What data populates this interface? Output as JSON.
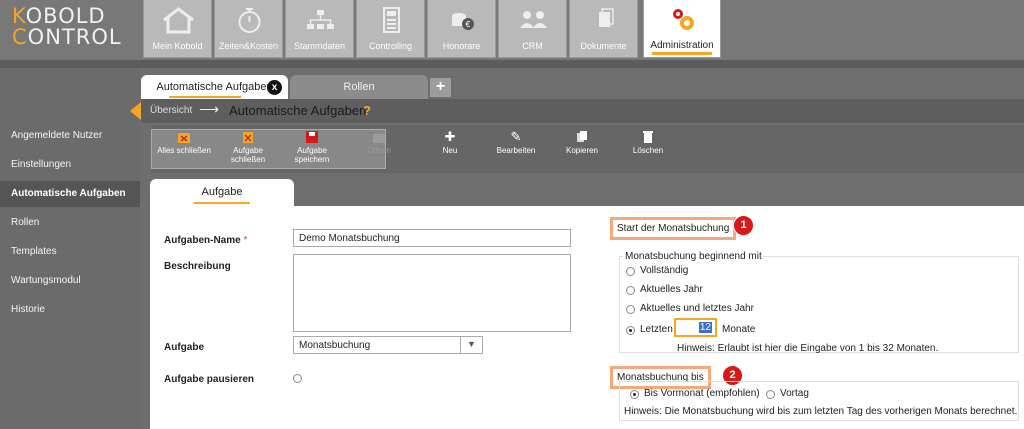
{
  "app": {
    "logo_line1": "OBOLD",
    "logo_line2": "ONTROL",
    "logo_k1": "K",
    "logo_k2": "C"
  },
  "nav": {
    "tabs": [
      {
        "label": "Mein Kobold",
        "icon": "home-icon"
      },
      {
        "label": "Zeiten&Kosten",
        "icon": "stopwatch-icon"
      },
      {
        "label": "Stammdaten",
        "icon": "hierarchy-icon"
      },
      {
        "label": "Controlling",
        "icon": "calculator-icon"
      },
      {
        "label": "Honorare",
        "icon": "coins-icon"
      },
      {
        "label": "CRM",
        "icon": "contacts-icon"
      },
      {
        "label": "Dokumente",
        "icon": "documents-icon"
      },
      {
        "label": "Administration",
        "icon": "gears-icon",
        "active": true
      }
    ]
  },
  "sidebar": {
    "items": [
      {
        "label": "Angemeldete Nutzer"
      },
      {
        "label": "Einstellungen"
      },
      {
        "label": "Automatische Aufgaben",
        "active": true
      },
      {
        "label": "Rollen"
      },
      {
        "label": "Templates"
      },
      {
        "label": "Wartungsmodul"
      },
      {
        "label": "Historie"
      }
    ]
  },
  "page_tabs": {
    "tab1": "Automatische Aufgaben",
    "tab2": "Rollen",
    "add": "+",
    "close": "x"
  },
  "breadcrumb": {
    "overview": "Übersicht",
    "arrow": "⟶",
    "current": "Automatische Aufgaben",
    "help": "?"
  },
  "toolbar": {
    "close_all": "Alles schließen",
    "close_task": "Aufgabe schließen",
    "save_task": "Aufgabe speichern",
    "open": "Öffnen",
    "new": "Neu",
    "edit": "Bearbeiten",
    "copy": "Kopieren",
    "delete": "Löschen"
  },
  "form_tab": "Aufgabe",
  "form": {
    "name_label": "Aufgaben-Name",
    "required_mark": "*",
    "name_value": "Demo Monatsbuchung",
    "description_label": "Beschreibung",
    "description_value": "",
    "task_label": "Aufgabe",
    "task_value": "Monatsbuchung",
    "pause_label": "Aufgabe pausieren"
  },
  "start_section": {
    "title": "Start der Monatsbuchung",
    "badge": "1",
    "legend": "Monatsbuchung beginnend mit",
    "options": [
      "Vollständig",
      "Aktuelles Jahr",
      "Aktuelles und letztes Jahr"
    ],
    "last_label": "Letzten",
    "last_value": "12",
    "months_label": "Monate",
    "hint": "Hinweis: Erlaubt ist hier die Eingabe von 1 bis 32 Monaten."
  },
  "end_section": {
    "title": "Monatsbuchung bis",
    "badge": "2",
    "option1": "Bis Vormonat (empfohlen)",
    "option2": "Vortag",
    "hint": "Hinweis: Die Monatsbuchung wird bis zum letzten Tag des vorherigen Monats berechnet."
  },
  "colors": {
    "accent": "#f5a623",
    "badge": "#d8191b",
    "highlight": "#f5a87a"
  }
}
